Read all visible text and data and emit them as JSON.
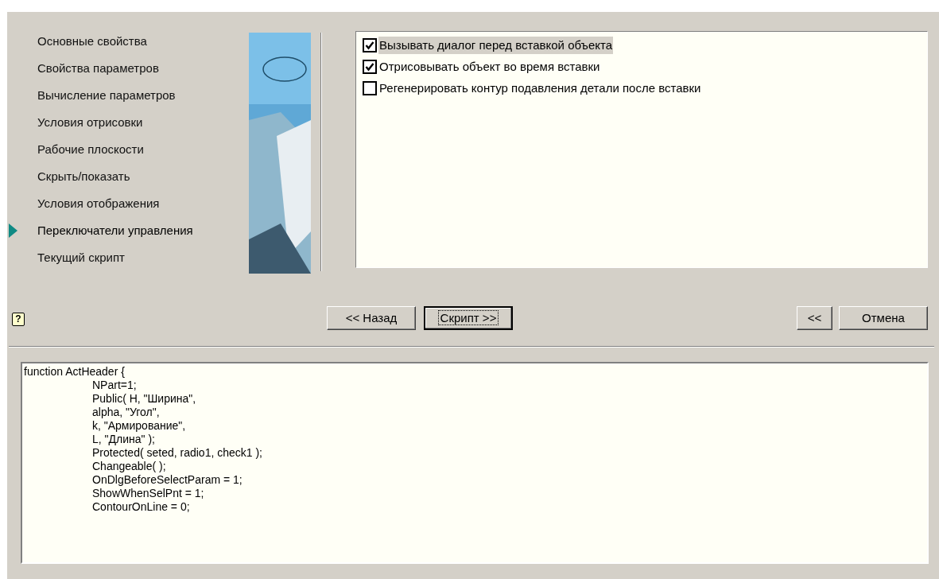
{
  "navigation": [
    {
      "label": "Основные свойства",
      "selected": false
    },
    {
      "label": "Свойства параметров",
      "selected": false
    },
    {
      "label": "Вычисление параметров",
      "selected": false
    },
    {
      "label": "Условия отрисовки",
      "selected": false
    },
    {
      "label": "Рабочие плоскости",
      "selected": false
    },
    {
      "label": "Скрыть/показать",
      "selected": false
    },
    {
      "label": "Условия отображения",
      "selected": false
    },
    {
      "label": "Переключатели управления",
      "selected": true
    },
    {
      "label": "Текущий скрипт",
      "selected": false
    }
  ],
  "options": [
    {
      "label": "Вызывать диалог перед вставкой объекта",
      "checked": true,
      "highlighted": true
    },
    {
      "label": "Отрисовывать объект во время вставки",
      "checked": true,
      "highlighted": false
    },
    {
      "label": "Регенерировать контур подавления детали после вставки",
      "checked": false,
      "highlighted": false
    }
  ],
  "help": {
    "label": "?"
  },
  "step_buttons": [
    {
      "label": "<< Назад",
      "default": false
    },
    {
      "label": "Скрипт >>",
      "default": true
    }
  ],
  "end_buttons": [
    {
      "label": "<<",
      "default": false
    },
    {
      "label": "Отмена",
      "default": false
    }
  ],
  "script": [
    {
      "kind": "head",
      "text": "function ActHeader {"
    },
    {
      "kind": "body",
      "text": "NPart=1;"
    },
    {
      "kind": "body",
      "text": "Public( H, \"Ширина\","
    },
    {
      "kind": "body",
      "text": "alpha, \"Угол\","
    },
    {
      "kind": "body",
      "text": "k, \"Армирование\","
    },
    {
      "kind": "body",
      "text": "L, \"Длина\" );"
    },
    {
      "kind": "body",
      "text": "Protected( seted, radio1, check1 );"
    },
    {
      "kind": "body",
      "text": "Changeable( );"
    },
    {
      "kind": "body",
      "text": "OnDlgBeforeSelectParam = 1;"
    },
    {
      "kind": "body",
      "text": "ShowWhenSelPnt = 1;"
    },
    {
      "kind": "body",
      "text": "ContourOnLine = 0;"
    }
  ]
}
